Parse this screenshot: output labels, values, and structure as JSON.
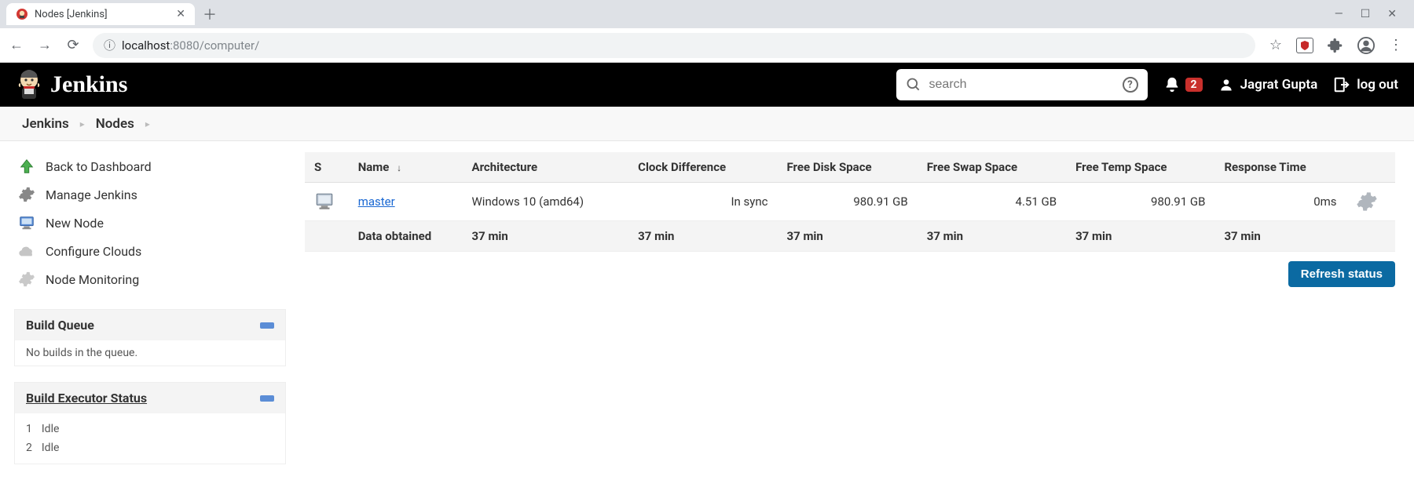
{
  "browser": {
    "tab_title": "Nodes [Jenkins]",
    "url_host": "localhost",
    "url_port": ":8080",
    "url_path": "/computer/"
  },
  "header": {
    "brand": "Jenkins",
    "search_placeholder": "search",
    "notif_count": "2",
    "user_name": "Jagrat Gupta",
    "logout_label": "log out"
  },
  "breadcrumbs": {
    "items": [
      "Jenkins",
      "Nodes"
    ]
  },
  "sidebar": {
    "items": [
      {
        "label": "Back to Dashboard",
        "icon": "up-arrow"
      },
      {
        "label": "Manage Jenkins",
        "icon": "gear"
      },
      {
        "label": "New Node",
        "icon": "computer"
      },
      {
        "label": "Configure Clouds",
        "icon": "cloud"
      },
      {
        "label": "Node Monitoring",
        "icon": "gear-light"
      }
    ]
  },
  "build_queue": {
    "title": "Build Queue",
    "empty_msg": "No builds in the queue."
  },
  "executors": {
    "title": "Build Executor Status",
    "rows": [
      {
        "num": "1",
        "status": "Idle"
      },
      {
        "num": "2",
        "status": "Idle"
      }
    ]
  },
  "table": {
    "columns": {
      "s": "S",
      "name": "Name",
      "arch": "Architecture",
      "clock": "Clock Difference",
      "disk": "Free Disk Space",
      "swap": "Free Swap Space",
      "temp": "Free Temp Space",
      "resp": "Response Time"
    },
    "sort_indicator": "↓",
    "rows": [
      {
        "name": "master",
        "arch": "Windows 10 (amd64)",
        "clock": "In sync",
        "disk": "980.91 GB",
        "swap": "4.51 GB",
        "temp": "980.91 GB",
        "resp": "0ms"
      }
    ],
    "summary": {
      "label": "Data obtained",
      "arch": "37 min",
      "clock": "37 min",
      "disk": "37 min",
      "swap": "37 min",
      "temp": "37 min",
      "resp": "37 min"
    }
  },
  "refresh_label": "Refresh status"
}
